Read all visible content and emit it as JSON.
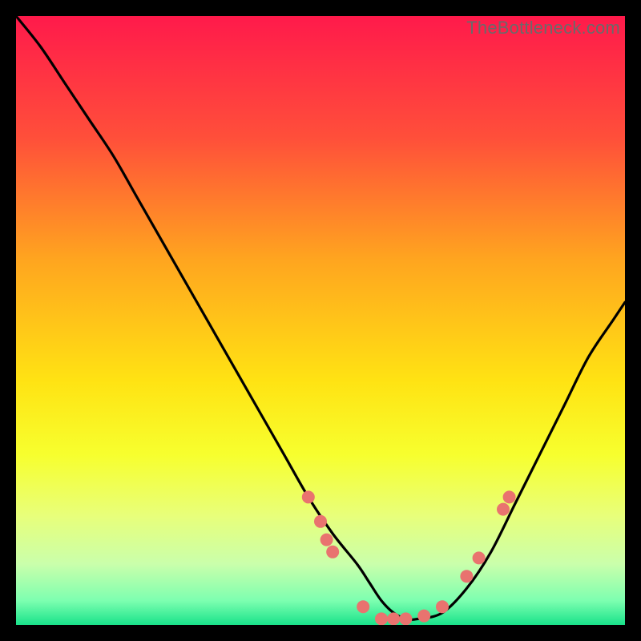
{
  "watermark": "TheBottleneck.com",
  "chart_data": {
    "type": "line",
    "title": "",
    "xlabel": "",
    "ylabel": "",
    "xlim": [
      0,
      100
    ],
    "ylim": [
      0,
      100
    ],
    "background_gradient": {
      "stops": [
        {
          "offset": 0.0,
          "color": "#ff1a4b"
        },
        {
          "offset": 0.2,
          "color": "#ff4f3a"
        },
        {
          "offset": 0.4,
          "color": "#ffa51f"
        },
        {
          "offset": 0.6,
          "color": "#ffe313"
        },
        {
          "offset": 0.72,
          "color": "#f7ff2e"
        },
        {
          "offset": 0.82,
          "color": "#e8ff7a"
        },
        {
          "offset": 0.9,
          "color": "#caffab"
        },
        {
          "offset": 0.96,
          "color": "#7dffb0"
        },
        {
          "offset": 1.0,
          "color": "#19e28a"
        }
      ]
    },
    "series": [
      {
        "name": "bottleneck-curve",
        "color": "#000000",
        "x": [
          0,
          4,
          8,
          12,
          16,
          20,
          24,
          28,
          32,
          36,
          40,
          44,
          48,
          52,
          56,
          58,
          60,
          62,
          64,
          66,
          70,
          74,
          78,
          82,
          86,
          90,
          94,
          98,
          100
        ],
        "y": [
          100,
          95,
          89,
          83,
          77,
          70,
          63,
          56,
          49,
          42,
          35,
          28,
          21,
          15,
          10,
          7,
          4,
          2,
          1,
          1,
          2,
          6,
          12,
          20,
          28,
          36,
          44,
          50,
          53
        ]
      }
    ],
    "markers": {
      "name": "highlight-dots",
      "color": "#e9736f",
      "radius": 8,
      "points": [
        {
          "x": 48,
          "y": 21
        },
        {
          "x": 50,
          "y": 17
        },
        {
          "x": 51,
          "y": 14
        },
        {
          "x": 52,
          "y": 12
        },
        {
          "x": 57,
          "y": 3
        },
        {
          "x": 60,
          "y": 1
        },
        {
          "x": 62,
          "y": 1
        },
        {
          "x": 64,
          "y": 1
        },
        {
          "x": 67,
          "y": 1.5
        },
        {
          "x": 70,
          "y": 3
        },
        {
          "x": 74,
          "y": 8
        },
        {
          "x": 76,
          "y": 11
        },
        {
          "x": 80,
          "y": 19
        },
        {
          "x": 81,
          "y": 21
        }
      ]
    }
  }
}
